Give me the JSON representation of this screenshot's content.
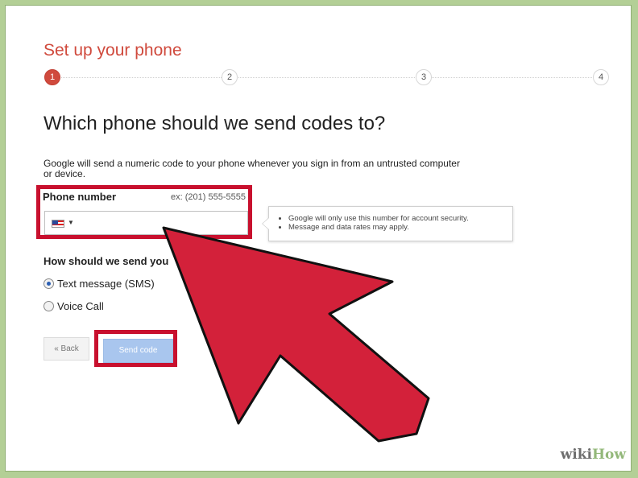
{
  "setup": {
    "title": "Set up your phone",
    "steps": [
      "1",
      "2",
      "3",
      "4"
    ],
    "current_step": 1
  },
  "heading": "Which phone should we send codes to?",
  "description": "Google will send a numeric code to your phone whenever you sign in from an untrusted computer or device.",
  "phone": {
    "label": "Phone number",
    "example": "ex: (201) 555-5555",
    "value": "",
    "country_icon": "us-flag-icon"
  },
  "tooltip": {
    "items": [
      "Google will only use this number for account security.",
      "Message and data rates may apply."
    ]
  },
  "method": {
    "label": "How should we send you",
    "options": [
      "Text message (SMS)",
      "Voice Call"
    ],
    "selected": "Text message (SMS)"
  },
  "buttons": {
    "back": "« Back",
    "send": "Send code"
  },
  "colors": {
    "highlight": "#c8102e",
    "arrow": "#d3213a",
    "accent": "#d04a3d",
    "frame": "#b3cf96"
  },
  "watermark": {
    "wiki": "wiki",
    "how": "How"
  }
}
